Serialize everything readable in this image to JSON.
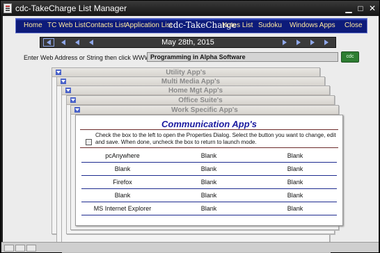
{
  "window": {
    "title": "cdc-TakeCharge List Manager",
    "minimize": "▁",
    "maximize": "□",
    "close": "✕"
  },
  "menu": {
    "items": [
      "Home",
      "TC Web List",
      "Contacts List",
      "Application List",
      "Notes List",
      "Sudoku",
      "Windows Apps",
      "Close"
    ],
    "brand": "cdc-TakeCharge"
  },
  "date": "May 28th, 2015",
  "web": {
    "label": "Enter Web Address or String then click WWW Link:",
    "value": "Programming in Alpha Software",
    "go_label": "cdc"
  },
  "panels": [
    "Utility App's",
    "Multi Media App's",
    "Home Mgt App's",
    "Office Suite's",
    "Work Specific App's"
  ],
  "active_panel": {
    "title": "Communication App's",
    "instructions": "Check the box to the left to open the Properties Dialog. Select the button you want to change, edit and save. When done, uncheck the box to return to launch mode.",
    "rows": [
      [
        "pcAnywhere",
        "Blank",
        "Blank"
      ],
      [
        "Blank",
        "Blank",
        "Blank"
      ],
      [
        "Firefox",
        "Blank",
        "Blank"
      ],
      [
        "Blank",
        "Blank",
        "Blank"
      ],
      [
        "MS Internet Explorer",
        "Blank",
        "Blank"
      ]
    ]
  },
  "colors": {
    "menubar": "#0d1b7a",
    "menu_text": "#ffe9a0",
    "panel_title": "#1a1aa0",
    "row_rule": "#1d2b8f"
  }
}
